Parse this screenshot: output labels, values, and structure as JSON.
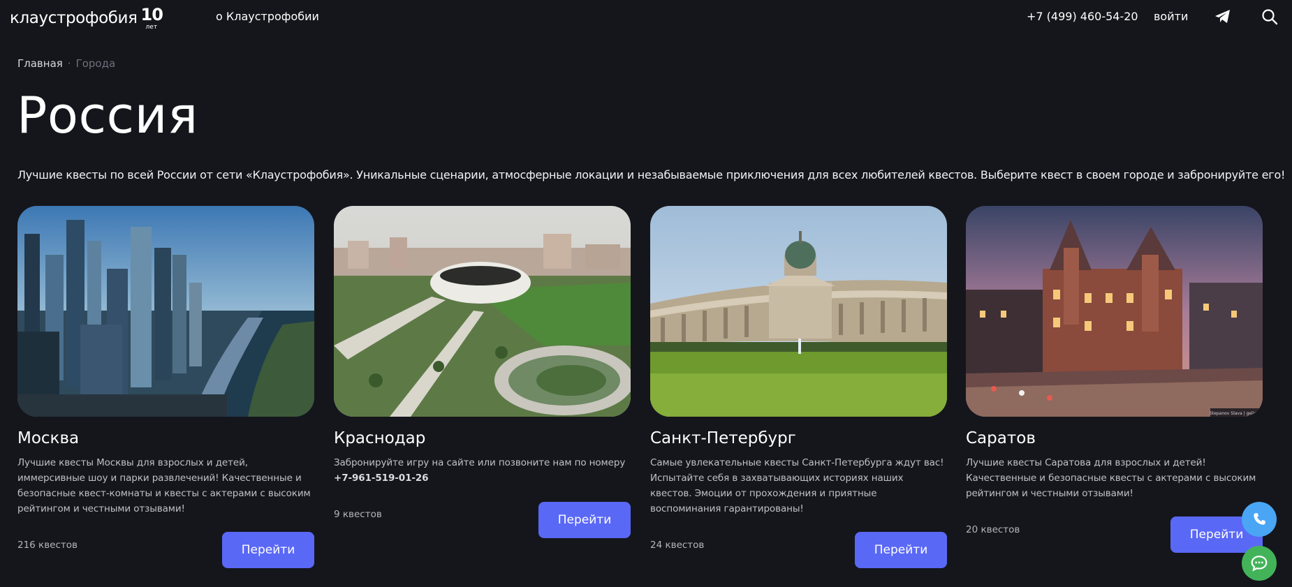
{
  "header": {
    "logo_text": "клаустрофобия",
    "logo_badge_number": "10",
    "logo_badge_caption": "лет",
    "nav_about": "о Клаустрофобии",
    "phone": "+7 (499) 460-54-20",
    "login": "войти"
  },
  "breadcrumb": {
    "home": "Главная",
    "separator": "·",
    "current": "Города"
  },
  "page": {
    "title": "Россия",
    "intro": "Лучшие квесты по всей России от сети «Клаустрофобия». Уникальные сценарии, атмосферные локации и незабываемые приключения для всех любителей квестов. Выберите квест в своем городе и забронируйте его!"
  },
  "cities": [
    {
      "name": "Москва",
      "description": "Лучшие квесты Москвы для взрослых и детей, иммерсивные шоу и парки развлечений! Качественные и безопасные квест-комнаты и квесты с актерами с высоким рейтингом и честными отзывами!",
      "count": "216 квестов",
      "button": "Перейти"
    },
    {
      "name": "Краснодар",
      "description": "Забронируйте игру на сайте или позвоните нам по номеру",
      "description_phone": "+7-961-519-01-26",
      "count": "9 квестов",
      "button": "Перейти"
    },
    {
      "name": "Санкт-Петербург",
      "description": "Самые увлекательные квесты Санкт-Петербурга ждут вас! Испытайте себя в захватывающих историях наших квестов. Эмоции от прохождения и приятные воспоминания гарантированы!",
      "count": "24 квестов",
      "button": "Перейти"
    },
    {
      "name": "Саратов",
      "description": "Лучшие квесты Саратова для взрослых и детей! Качественные и безопасные квесты с актерами с высоким рейтингом и честными отзывами!",
      "count": "20 квестов",
      "button": "Перейти",
      "photo_credit": "Stepanov Slava | gelio"
    }
  ],
  "colors": {
    "background": "#15161c",
    "accent_button": "#5a68f6",
    "fab_phone": "#4aa6f4",
    "fab_chat": "#43b35a"
  },
  "icons": [
    "telegram-icon",
    "search-icon",
    "phone-icon",
    "chat-icon"
  ]
}
